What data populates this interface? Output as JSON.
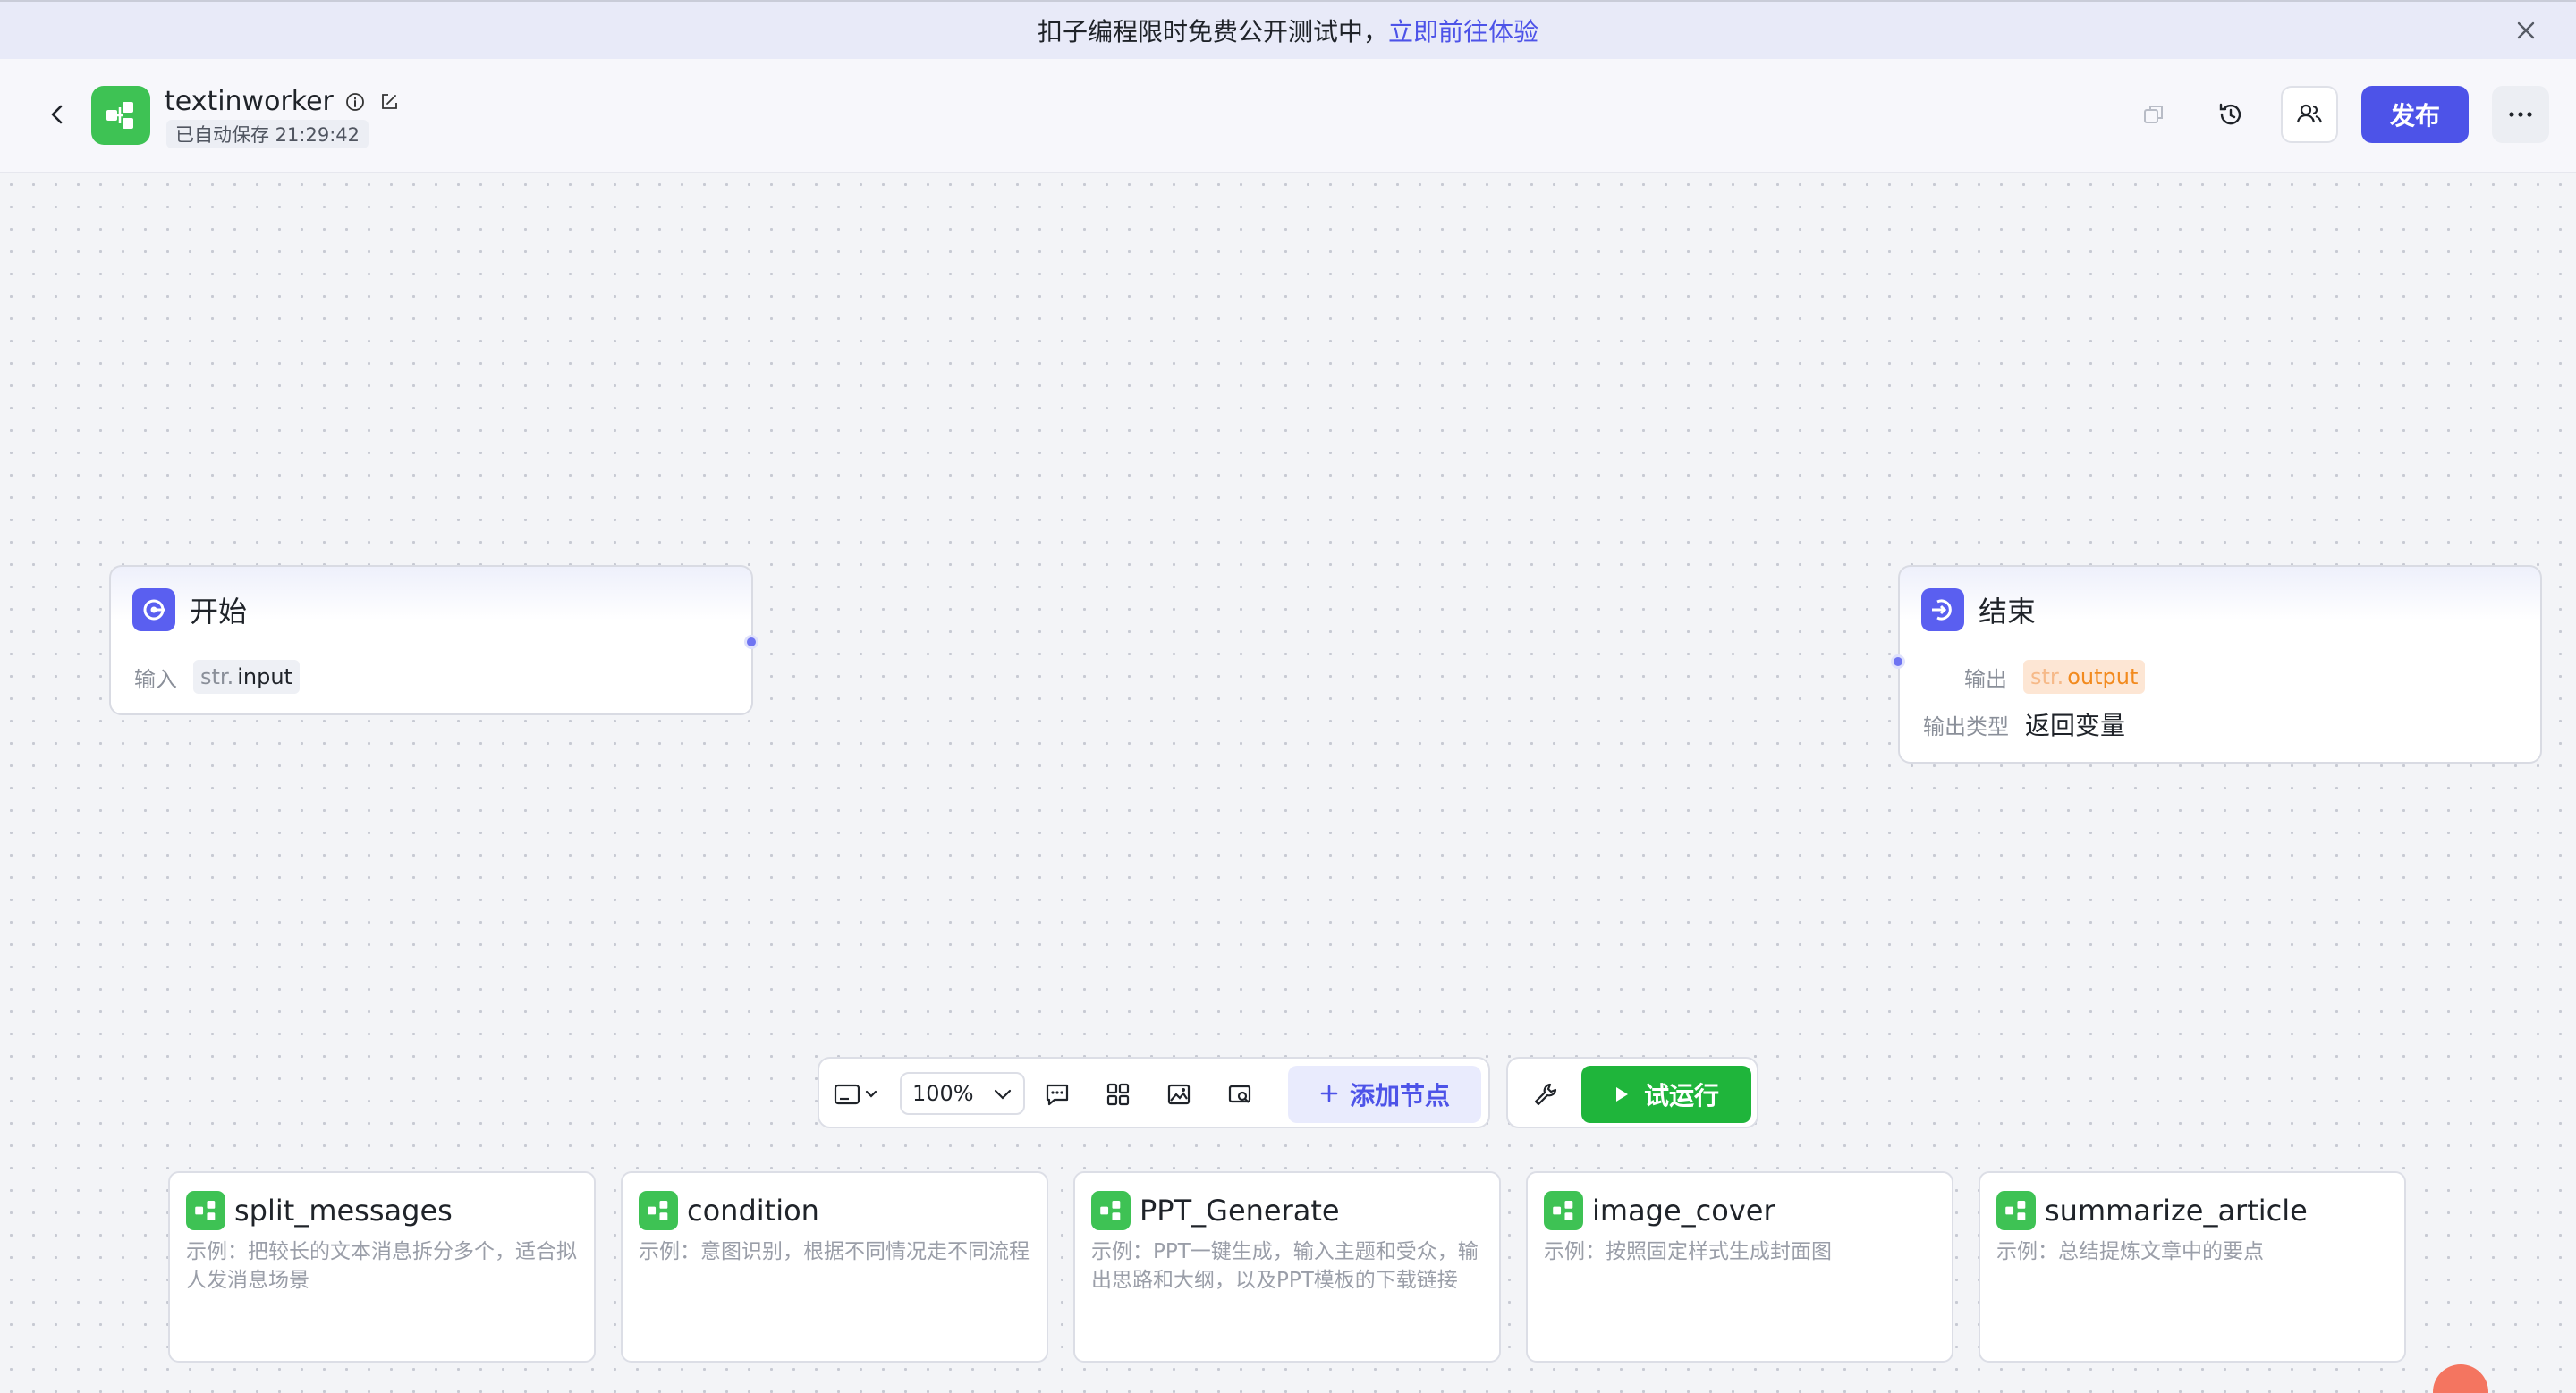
{
  "banner": {
    "text": "扣子编程限时免费公开测试中，",
    "link": "立即前往体验"
  },
  "header": {
    "app_name": "textinworker",
    "autosave": "已自动保存 21:29:42",
    "publish_label": "发布"
  },
  "nodes": {
    "start": {
      "title": "开始",
      "input_label": "输入",
      "var_type": "str.",
      "var_name": "input"
    },
    "end": {
      "title": "结束",
      "output_label": "输出",
      "var_type": "str.",
      "var_name": "output",
      "output_type_label": "输出类型",
      "output_type_value": "返回变量"
    }
  },
  "toolbar": {
    "zoom": "100%",
    "add_node_label": "添加节点",
    "trial_run_label": "试运行"
  },
  "templates": [
    {
      "name": "split_messages",
      "desc": "示例：把较长的文本消息拆分多个，适合拟人发消息场景"
    },
    {
      "name": "condition",
      "desc": "示例：意图识别，根据不同情况走不同流程"
    },
    {
      "name": "PPT_Generate",
      "desc": "示例：PPT一键生成，输入主题和受众，输出思路和大纲，以及PPT模板的下载链接"
    },
    {
      "name": "image_cover",
      "desc": "示例：按照固定样式生成封面图"
    },
    {
      "name": "summarize_article",
      "desc": "示例：总结提炼文章中的要点"
    }
  ],
  "colors": {
    "accent": "#4d53e8",
    "run_green": "#1fb53b",
    "logo_green": "#3ec254",
    "node_icon": "#5a5ff0"
  }
}
